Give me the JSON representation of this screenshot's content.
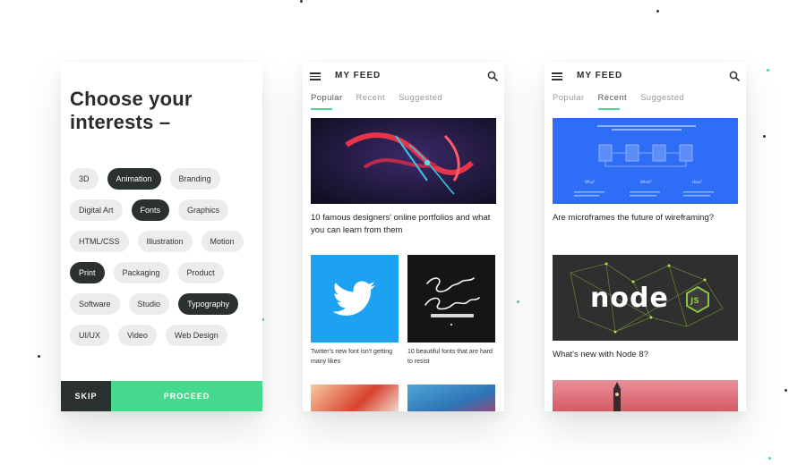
{
  "interests": {
    "title": "Choose your interests –",
    "chips": [
      {
        "label": "3D",
        "selected": false
      },
      {
        "label": "Animation",
        "selected": true
      },
      {
        "label": "Branding",
        "selected": false
      },
      {
        "label": "Digital Art",
        "selected": false
      },
      {
        "label": "Fonts",
        "selected": true
      },
      {
        "label": "Graphics",
        "selected": false
      },
      {
        "label": "HTML/CSS",
        "selected": false
      },
      {
        "label": "Illustration",
        "selected": false
      },
      {
        "label": "Motion",
        "selected": false
      },
      {
        "label": "Print",
        "selected": true
      },
      {
        "label": "Packaging",
        "selected": false
      },
      {
        "label": "Product",
        "selected": false
      },
      {
        "label": "Software",
        "selected": false
      },
      {
        "label": "Studio",
        "selected": false
      },
      {
        "label": "Typography",
        "selected": true
      },
      {
        "label": "UI/UX",
        "selected": false
      },
      {
        "label": "Video",
        "selected": false
      },
      {
        "label": "Web Design",
        "selected": false
      }
    ],
    "skip_label": "SKIP",
    "proceed_label": "PROCEED"
  },
  "feed_popular": {
    "title": "MY FEED",
    "tabs": [
      "Popular",
      "Recent",
      "Suggested"
    ],
    "active_tab": "Popular",
    "main_card_title": "10 famous designers' online portfolios and what you can learn from them",
    "small_cards": [
      {
        "caption": "Twitter's new font isn't getting many likes"
      },
      {
        "caption": "10 beautiful fonts that are hard to resist"
      }
    ]
  },
  "feed_recent": {
    "title": "MY FEED",
    "tabs": [
      "Popular",
      "Recent",
      "Suggested"
    ],
    "active_tab": "Recent",
    "card1_title": "Are microframes the future of wireframing?",
    "card2_title": "What's new with Node 8?",
    "microframe_labels": [
      "Why?",
      "What?",
      "How?"
    ]
  },
  "colors": {
    "accent": "#45d98d",
    "dark": "#2a3130",
    "chip_bg": "#ececec",
    "twitter_blue": "#1da1f2",
    "wireframe_blue": "#2e6df6"
  },
  "icons": [
    "menu-icon",
    "search-icon",
    "twitter-bird-icon",
    "nodejs-logo"
  ]
}
